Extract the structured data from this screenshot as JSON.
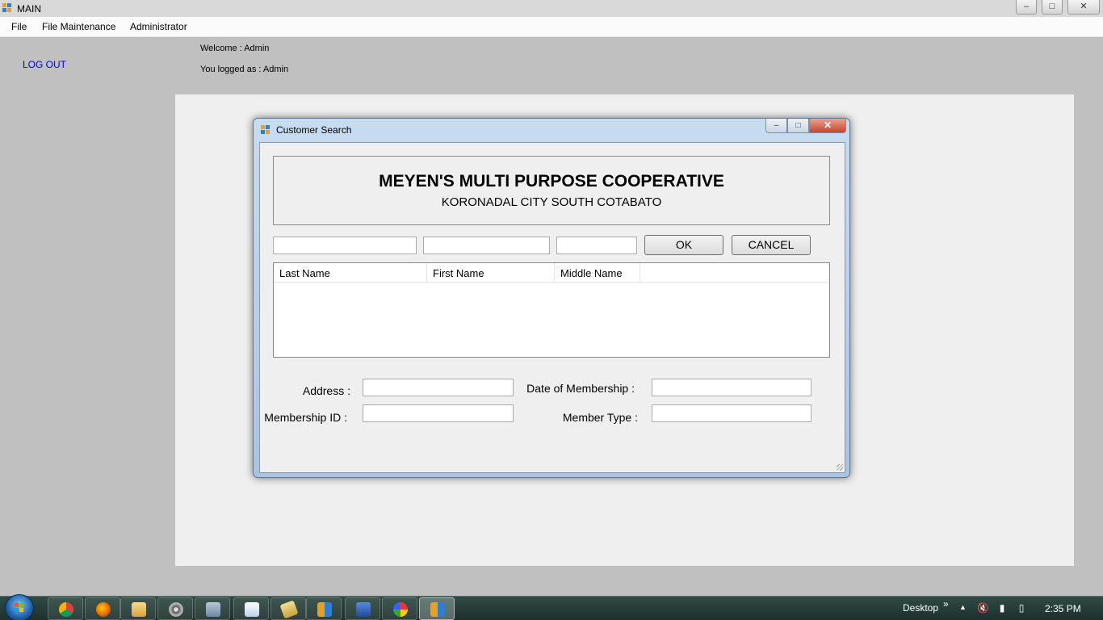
{
  "main_window": {
    "title": "MAIN",
    "controls": {
      "minimize": "–",
      "maximize": "□",
      "close": "✕"
    }
  },
  "menu": {
    "items": [
      {
        "label": "File"
      },
      {
        "label": "File Maintenance"
      },
      {
        "label": "Administrator"
      }
    ]
  },
  "session": {
    "logout_label": "LOG OUT",
    "welcome_text": "Welcome  : Admin",
    "logged_text": "You logged as : Admin"
  },
  "dialog": {
    "title": "Customer Search",
    "controls": {
      "minimize": "–",
      "maximize": "□",
      "close": "✕"
    },
    "org_name": "MEYEN'S MULTI PURPOSE COOPERATIVE",
    "org_address": "KORONADAL CITY SOUTH COTABATO",
    "search": {
      "last_name": "",
      "first_name": "",
      "middle_name": ""
    },
    "ok_label": "OK",
    "cancel_label": "CANCEL",
    "list_columns": [
      "Last Name",
      "First Name",
      "Middle Name"
    ],
    "fields": {
      "address": {
        "label": "Address :",
        "value": ""
      },
      "membership_id": {
        "label": "Membership ID :",
        "value": ""
      },
      "date_of_membership": {
        "label": "Date of Membership :",
        "value": ""
      },
      "member_type": {
        "label": "Member Type :",
        "value": ""
      }
    }
  },
  "taskbar": {
    "desktop_label": "Desktop",
    "chevron": "»",
    "clock": "2:35 PM",
    "apps": [
      "chrome-icon",
      "firefox-icon",
      "explorer-icon",
      "media-icon",
      "tool-icon",
      "notepad-icon",
      "ticket-icon",
      "app-icon",
      "monitor-icon",
      "paint-icon",
      "winform-icon"
    ]
  }
}
